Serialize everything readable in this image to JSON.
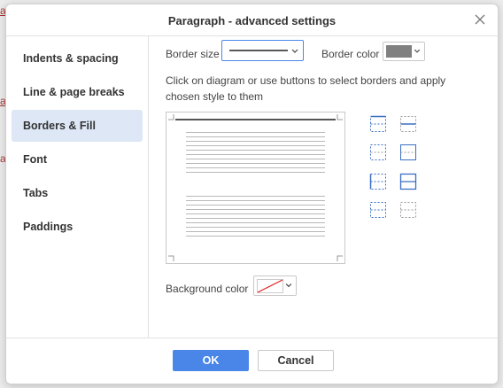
{
  "background_doc": {
    "fragments": [
      "a",
      "a",
      "a"
    ]
  },
  "dialog": {
    "title": "Paragraph - advanced settings",
    "close_icon": "close-icon"
  },
  "sidebar": {
    "items": [
      {
        "label": "Indents & spacing",
        "active": false
      },
      {
        "label": "Line & page breaks",
        "active": false
      },
      {
        "label": "Borders & Fill",
        "active": true
      },
      {
        "label": "Font",
        "active": false
      },
      {
        "label": "Tabs",
        "active": false
      },
      {
        "label": "Paddings",
        "active": false
      }
    ]
  },
  "borders": {
    "border_size_label": "Border size",
    "border_color_label": "Border color",
    "border_color_value": "#808080",
    "instructions": "Click on diagram or use buttons to select borders and apply chosen style to them",
    "background_color_label": "Background color",
    "background_color_value": "none"
  },
  "footer": {
    "ok_label": "OK",
    "cancel_label": "Cancel"
  },
  "colors": {
    "accent": "#4a86e8",
    "active_item_bg": "#dde7f6",
    "icon_blue": "#3a6fc4"
  }
}
